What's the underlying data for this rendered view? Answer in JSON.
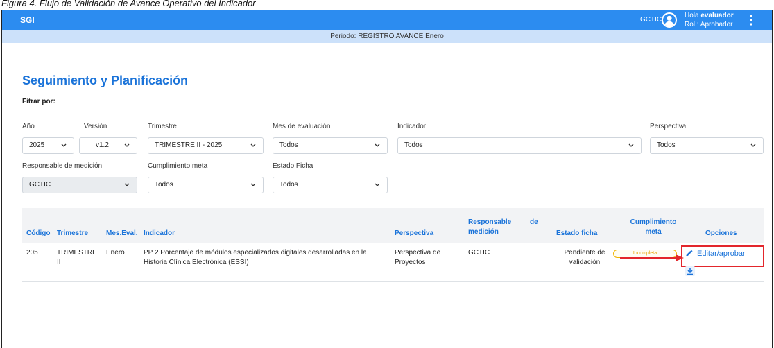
{
  "caption": "Figura 4. Flujo de Validación de Avance Operativo del Indicador",
  "topbar": {
    "app": "SGI",
    "org": "GCTIC",
    "greeting_prefix": "Hola ",
    "user": "evaluador",
    "role": "Rol : Aprobador"
  },
  "period": "Periodo: REGISTRO AVANCE Enero",
  "page": {
    "title": "Seguimiento y Planificación",
    "filter_by": "Fitrar por:"
  },
  "filters": {
    "anio": {
      "label": "Año",
      "value": "2025"
    },
    "version": {
      "label": "Versión",
      "value": "v1.2"
    },
    "trimestre": {
      "label": "Trimestre",
      "value": "TRIMESTRE II - 2025"
    },
    "mes": {
      "label": "Mes de evaluación",
      "value": "Todos"
    },
    "indicador": {
      "label": "Indicador",
      "value": "Todos"
    },
    "perspectiva": {
      "label": "Perspectiva",
      "value": "Todos"
    },
    "responsable": {
      "label": "Responsable de medición",
      "value": "GCTIC"
    },
    "cumplimiento": {
      "label": "Cumplimiento meta",
      "value": "Todos"
    },
    "estado": {
      "label": "Estado Ficha",
      "value": "Todos"
    }
  },
  "table": {
    "headers": {
      "codigo": "Código",
      "trimestre": "Trimestre",
      "mes": "Mes.Eval.",
      "indicador": "Indicador",
      "perspectiva": "Perspectiva",
      "responsable_1": "Responsable",
      "responsable_de": "de",
      "responsable_2": "medición",
      "estado": "Estado ficha",
      "cumplimiento_1": "Cumplimiento",
      "cumplimiento_2": "meta",
      "opciones": "Opciones"
    },
    "rows": [
      {
        "codigo": "205",
        "trimestre_1": "TRIMESTRE",
        "trimestre_2": "II",
        "mes": "Enero",
        "indicador_1": "PP 2 Porcentaje de módulos especializados digitales desarrolladas en la",
        "indicador_2": "Historia Clínica Electrónica (ESSI)",
        "perspectiva_1": "Perspectiva de",
        "perspectiva_2": "Proyectos",
        "responsable": "GCTIC",
        "estado_1": "Pendiente de",
        "estado_2": "validación",
        "cumplimiento": "Incompleta",
        "action": "Editar/aprobar"
      }
    ]
  },
  "colors": {
    "primary": "#2c8cf0",
    "period_bg": "#cce1fa",
    "title": "#1a73d9",
    "highlight": "#e3262c",
    "badge": "#f0b400"
  }
}
